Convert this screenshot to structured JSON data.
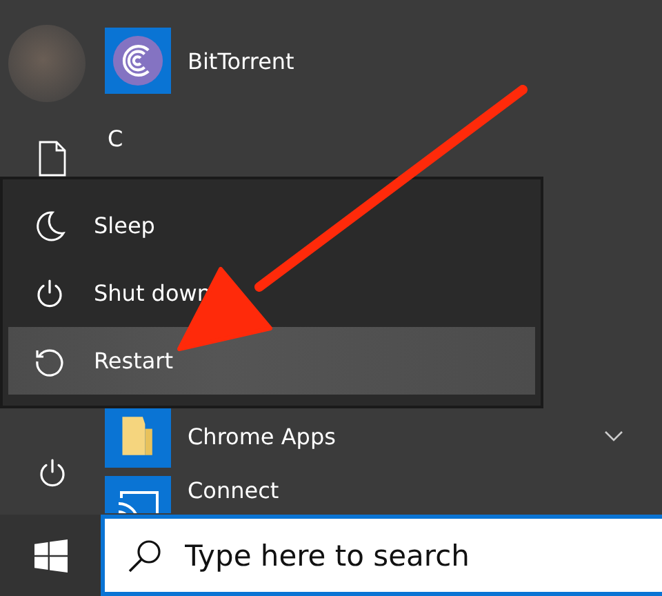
{
  "apps": [
    {
      "kind": "torrent",
      "label": "BitTorrent"
    },
    {
      "kind": "letter",
      "label": "C"
    },
    {
      "kind": "folder",
      "label": "Chrome Apps"
    },
    {
      "kind": "cast",
      "label": "Connect"
    }
  ],
  "power_menu": {
    "items": [
      {
        "kind": "sleep",
        "label": "Sleep",
        "selected": false
      },
      {
        "kind": "shutdown",
        "label": "Shut down",
        "selected": false
      },
      {
        "kind": "restart",
        "label": "Restart",
        "selected": true
      }
    ]
  },
  "search": {
    "placeholder": "Type here to search"
  }
}
